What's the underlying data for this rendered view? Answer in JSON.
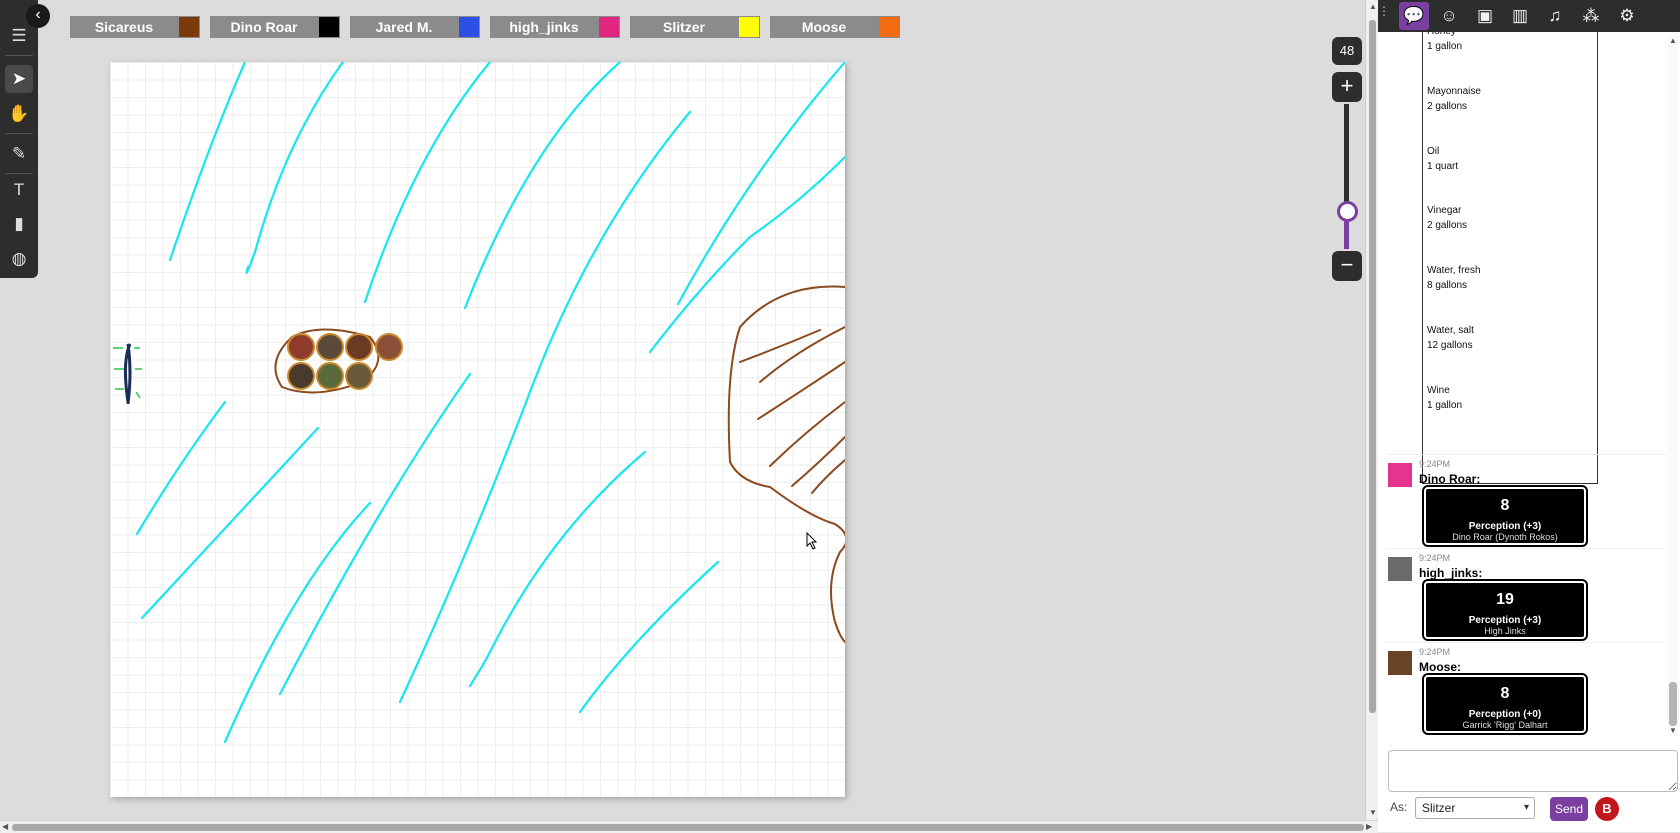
{
  "players": [
    {
      "name": "Sicareus",
      "color": "#7a3a0c"
    },
    {
      "name": "Dino Roar",
      "color": "#000000"
    },
    {
      "name": "Jared M.",
      "color": "#2d4fe5"
    },
    {
      "name": "high_jinks",
      "color": "#e0267f"
    },
    {
      "name": "Slitzer",
      "color": "#ffff00"
    },
    {
      "name": "Moose",
      "color": "#f26b12"
    }
  ],
  "toolbar": {
    "collapse_icon": "chevron-left",
    "tools": [
      {
        "name": "menu",
        "glyph": "☰",
        "active": false
      },
      {
        "name": "select",
        "glyph": "➤",
        "active": true
      },
      {
        "name": "pan",
        "glyph": "✋",
        "active": false
      },
      {
        "name": "draw",
        "glyph": "✎",
        "active": false
      },
      {
        "name": "text",
        "glyph": "T",
        "active": false
      },
      {
        "name": "measure",
        "glyph": "▮",
        "active": false
      },
      {
        "name": "fog",
        "glyph": "◍",
        "active": false
      }
    ]
  },
  "zoom": {
    "value": "48",
    "plus": "+",
    "minus": "−",
    "level": 0.26
  },
  "sidebar_tabs": [
    {
      "name": "chat",
      "glyph": "💬",
      "active": true
    },
    {
      "name": "journal-characters",
      "glyph": "☺",
      "active": false
    },
    {
      "name": "compendium",
      "glyph": "▣",
      "active": false
    },
    {
      "name": "library",
      "glyph": "▥",
      "active": false
    },
    {
      "name": "jukebox",
      "glyph": "♫",
      "active": false
    },
    {
      "name": "collections",
      "glyph": "⁂",
      "active": false
    },
    {
      "name": "settings",
      "glyph": "⚙",
      "active": false
    }
  ],
  "item_list": [
    {
      "name": "Honey",
      "qty": "1 gallon"
    },
    {
      "name": "Mayonnaise",
      "qty": "2 gallons"
    },
    {
      "name": "Oil",
      "qty": "1 quart"
    },
    {
      "name": "Vinegar",
      "qty": "2 gallons"
    },
    {
      "name": "Water, fresh",
      "qty": "8 gallons"
    },
    {
      "name": "Water, salt",
      "qty": "12 gallons"
    },
    {
      "name": "Wine",
      "qty": "1 gallon"
    }
  ],
  "messages": [
    {
      "time": "9:24PM",
      "who": "Dino Roar:",
      "result": "8",
      "label": "Perception (+3)",
      "char": "Dino Roar (Dynoth Rokos)",
      "avatar_color": "#e6338f"
    },
    {
      "time": "9:24PM",
      "who": "high_jinks:",
      "result": "19",
      "label": "Perception (+3)",
      "char": "High Jinks",
      "avatar_color": "#6b6b6b"
    },
    {
      "time": "9:24PM",
      "who": "Moose:",
      "result": "8",
      "label": "Perception (+0)",
      "char": "Garrick 'Rigg' Dalhart",
      "avatar_color": "#6a4426"
    }
  ],
  "chat_input": {
    "placeholder": ""
  },
  "speaking_as": {
    "label": "As:",
    "value": "Slitzer"
  },
  "send_label": "Send",
  "beyond_label": "B",
  "colors": {
    "accent": "#7a3fa0",
    "rain": "#16e6f0",
    "terrain": "#8b4a1e"
  }
}
